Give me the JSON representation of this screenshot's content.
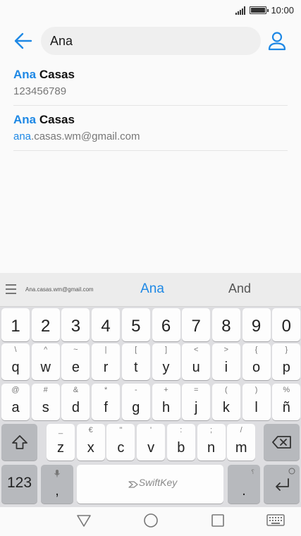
{
  "status": {
    "time": "10:00"
  },
  "search": {
    "query": "Ana"
  },
  "results": [
    {
      "name_match": "Ana",
      "name_rest": " Casas",
      "sub_match": "",
      "sub_rest": "123456789"
    },
    {
      "name_match": "Ana",
      "name_rest": " Casas",
      "sub_match": "ana",
      "sub_rest": ".casas.wm@gmail.com"
    }
  ],
  "suggestions": {
    "left": "Ana.casas.wm@gmail.com",
    "middle": "Ana",
    "right": "And"
  },
  "keyboard": {
    "num_row": [
      "1",
      "2",
      "3",
      "4",
      "5",
      "6",
      "7",
      "8",
      "9",
      "0"
    ],
    "row1": [
      {
        "k": "q",
        "a": "\\"
      },
      {
        "k": "w",
        "a": "^"
      },
      {
        "k": "e",
        "a": "~"
      },
      {
        "k": "r",
        "a": "|"
      },
      {
        "k": "t",
        "a": "["
      },
      {
        "k": "y",
        "a": "]"
      },
      {
        "k": "u",
        "a": "<"
      },
      {
        "k": "i",
        "a": ">"
      },
      {
        "k": "o",
        "a": "{"
      },
      {
        "k": "p",
        "a": "}"
      }
    ],
    "row2": [
      {
        "k": "a",
        "a": "@"
      },
      {
        "k": "s",
        "a": "#"
      },
      {
        "k": "d",
        "a": "&"
      },
      {
        "k": "f",
        "a": "*"
      },
      {
        "k": "g",
        "a": "-"
      },
      {
        "k": "h",
        "a": "+"
      },
      {
        "k": "j",
        "a": "="
      },
      {
        "k": "k",
        "a": "("
      },
      {
        "k": "l",
        "a": ")"
      },
      {
        "k": "ñ",
        "a": "%"
      }
    ],
    "row3": [
      {
        "k": "z",
        "a": "_"
      },
      {
        "k": "x",
        "a": "€"
      },
      {
        "k": "c",
        "a": "\""
      },
      {
        "k": "v",
        "a": "'"
      },
      {
        "k": "b",
        "a": ":"
      },
      {
        "k": "n",
        "a": ";"
      },
      {
        "k": "m",
        "a": "/"
      }
    ],
    "symbols_label": "123",
    "comma": ",",
    "period": ".",
    "space_brand": "SwiftKey"
  },
  "colors": {
    "accent": "#1e88e5"
  }
}
